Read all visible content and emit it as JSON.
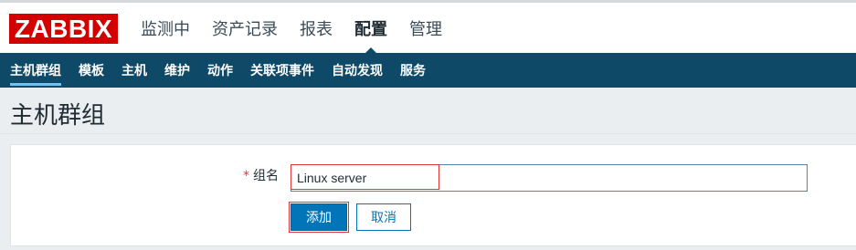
{
  "app": {
    "logo": "ZABBIX"
  },
  "main_menu": [
    "监测中",
    "资产记录",
    "报表",
    "配置",
    "管理"
  ],
  "sub_menu": [
    "主机群组",
    "模板",
    "主机",
    "维护",
    "动作",
    "关联项事件",
    "自动发现",
    "服务"
  ],
  "page": {
    "title": "主机群组"
  },
  "form": {
    "required_mark": "*",
    "group_name_label": "组名",
    "group_name_value": "Linux server",
    "add_label": "添加",
    "cancel_label": "取消"
  },
  "colors": {
    "brand": "#d40000",
    "nav": "#0e4968",
    "accent": "#0275b8",
    "highlight": "#e33734"
  }
}
